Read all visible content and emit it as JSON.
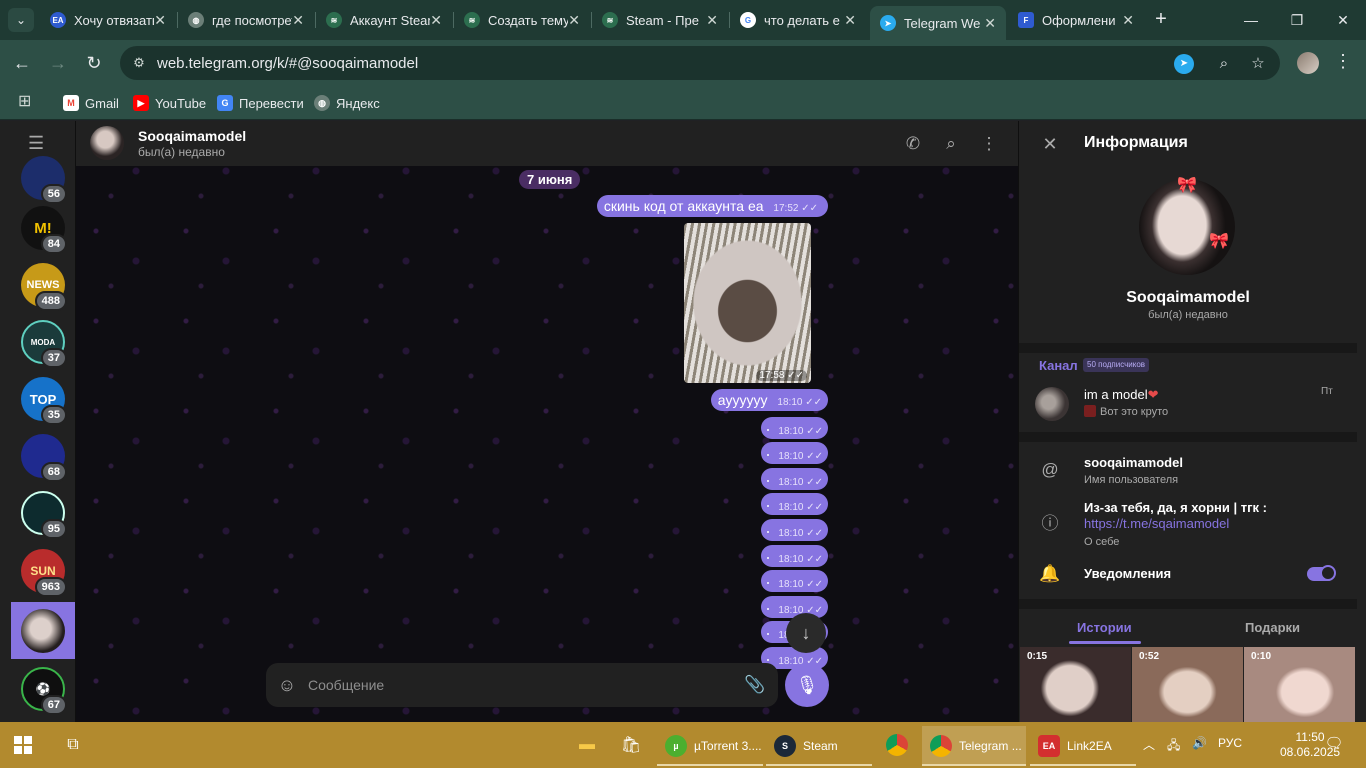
{
  "browser": {
    "tabs": [
      {
        "title": "Хочу отвязать",
        "favicon": "ea-icon",
        "color": "#2f5bd0"
      },
      {
        "title": "где посмотреть",
        "favicon": "globe-icon",
        "color": "#6b7f78"
      },
      {
        "title": "Аккаунт Steam",
        "favicon": "steam-stack-icon",
        "color": "#2c6e4f"
      },
      {
        "title": "Создать тему",
        "favicon": "steam-stack-icon",
        "color": "#2c6e4f"
      },
      {
        "title": "Steam - Пре",
        "favicon": "steam-stack-icon",
        "color": "#2c6e4f"
      },
      {
        "title": "что делать е",
        "favicon": "google-icon",
        "color": "#ffffff"
      },
      {
        "title": "Telegram We",
        "favicon": "telegram-icon",
        "color": "#2aabee"
      },
      {
        "title": "Оформлени",
        "favicon": "f-icon",
        "color": "#2f5bd0"
      }
    ],
    "url": "web.telegram.org/k/#@sooqaimamodel",
    "bookmarks": [
      {
        "label": "Gmail",
        "icon": "gmail-icon"
      },
      {
        "label": "YouTube",
        "icon": "youtube-icon"
      },
      {
        "label": "Перевести",
        "icon": "translate-icon"
      },
      {
        "label": "Яндекс",
        "icon": "globe-icon"
      }
    ]
  },
  "rail": {
    "chats": [
      {
        "badge": "56",
        "icon": "channel-avatar",
        "color": "#1c2d6b",
        "text": ""
      },
      {
        "badge": "84",
        "icon": "channel-avatar",
        "color": "#111111",
        "text": "M!"
      },
      {
        "badge": "488",
        "icon": "channel-avatar",
        "color": "#c79a18",
        "text": "NEWS"
      },
      {
        "badge": "37",
        "icon": "channel-avatar",
        "color": "#1b3b3b",
        "text": "MODA"
      },
      {
        "badge": "35",
        "icon": "channel-avatar",
        "color": "#1672c9",
        "text": "TOP"
      },
      {
        "badge": "68",
        "icon": "channel-avatar",
        "color": "#1f2a8f",
        "text": ""
      },
      {
        "badge": "95",
        "icon": "channel-avatar",
        "color": "#0d2b2e",
        "text": ""
      },
      {
        "badge": "963",
        "icon": "channel-avatar",
        "color": "#b92c2c",
        "text": "SUN"
      },
      {
        "badge": "67",
        "icon": "channel-avatar",
        "color": "#0f0f0f",
        "text": ""
      }
    ]
  },
  "chat": {
    "name": "Sooqaimamodel",
    "status": "был(а) недавно",
    "date": "7 июня",
    "messages": [
      {
        "text": "скинь код от аккаунта еа",
        "time": "17:52"
      },
      {
        "text": "",
        "time": "17:58"
      },
      {
        "text": "ayyyyyy",
        "time": "18:10"
      }
    ],
    "dot_times": [
      "18:10",
      "18:10",
      "18:10",
      "18:10",
      "18:10",
      "18:10",
      "18:10",
      "18:10",
      "18:10",
      "18:10"
    ],
    "input_placeholder": "Сообщение"
  },
  "info": {
    "title": "Информация",
    "name": "Sooqaimamodel",
    "status": "был(а) недавно",
    "channel_label": "Канал",
    "subscribers": "50 подписчиков",
    "channel_title": "im a model",
    "channel_last": "Вот это круто",
    "channel_day": "Пт",
    "username": "sooqaimamodel",
    "username_label": "Имя пользователя",
    "bio": "Из-за тебя, да, я хорни | тгк :",
    "bio_link": "https://t.me/sqaimamodel",
    "bio_label": "О себе",
    "notifications": "Уведомления",
    "notifications_on": true,
    "tabs": [
      "Истории",
      "Подарки"
    ],
    "stories": [
      "0:15",
      "0:52",
      "0:10"
    ]
  },
  "taskbar": {
    "items": [
      {
        "label": "µTorrent 3....",
        "icon": "utorrent-icon",
        "color": "#4caf2f"
      },
      {
        "label": "Steam",
        "icon": "steam-icon",
        "color": "#1b2838"
      },
      {
        "label": "Telegram ...",
        "icon": "chrome-icon",
        "color": "#db4437"
      },
      {
        "label": "Link2EA",
        "icon": "ea-icon",
        "color": "#d32f2f"
      }
    ],
    "lang": "РУС",
    "time": "11:50",
    "date": "08.06.2025"
  }
}
